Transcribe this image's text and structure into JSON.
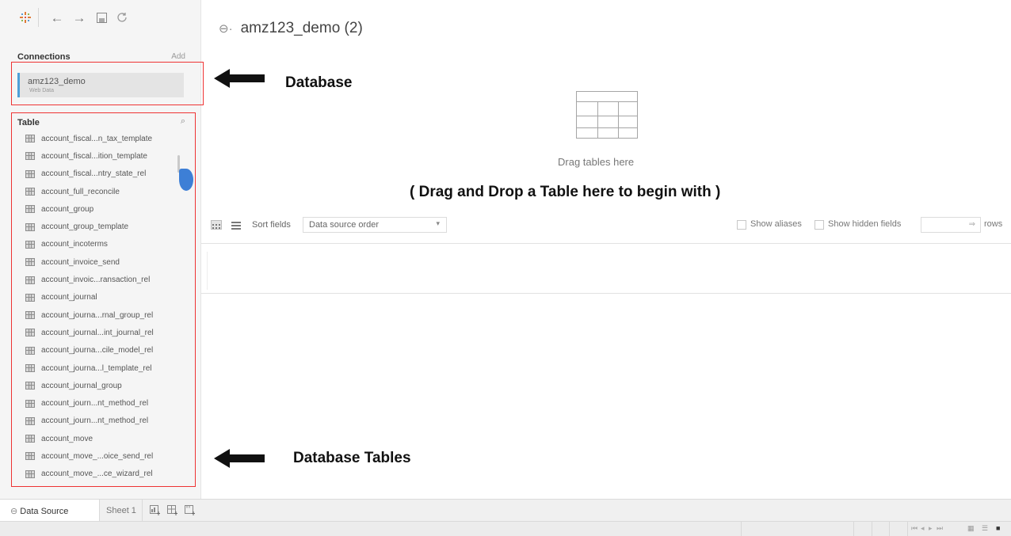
{
  "toolbar": {
    "icons": [
      "logo-icon",
      "back-icon",
      "forward-icon",
      "save-icon",
      "refresh-icon"
    ]
  },
  "connections": {
    "title": "Connections",
    "add_label": "Add",
    "items": [
      {
        "name": "amz123_demo",
        "type": "Web Data"
      }
    ]
  },
  "tables": {
    "title": "Table",
    "items": [
      "account_fiscal...n_tax_template",
      "account_fiscal...ition_template",
      "account_fiscal...ntry_state_rel",
      "account_full_reconcile",
      "account_group",
      "account_group_template",
      "account_incoterms",
      "account_invoice_send",
      "account_invoic...ransaction_rel",
      "account_journal",
      "account_journa...rnal_group_rel",
      "account_journal...int_journal_rel",
      "account_journa...cile_model_rel",
      "account_journa...l_template_rel",
      "account_journal_group",
      "account_journ...nt_method_rel",
      "account_journ...nt_method_rel",
      "account_move",
      "account_move_...oice_send_rel",
      "account_move_...ce_wizard_rel"
    ]
  },
  "main": {
    "datasource_title": "amz123_demo (2)",
    "drop_hint": "Drag tables here"
  },
  "annotations": {
    "database": "Database",
    "drag_drop": "( Drag and Drop a Table here to begin with )",
    "database_tables": "Database Tables",
    "color": "#e33333"
  },
  "fields_bar": {
    "sort_label": "Sort fields",
    "sort_value": "Data source order",
    "show_aliases": "Show aliases",
    "show_hidden": "Show hidden fields",
    "rows_label": "rows"
  },
  "tabs": {
    "data_source": "Data Source",
    "sheet": "Sheet 1"
  }
}
